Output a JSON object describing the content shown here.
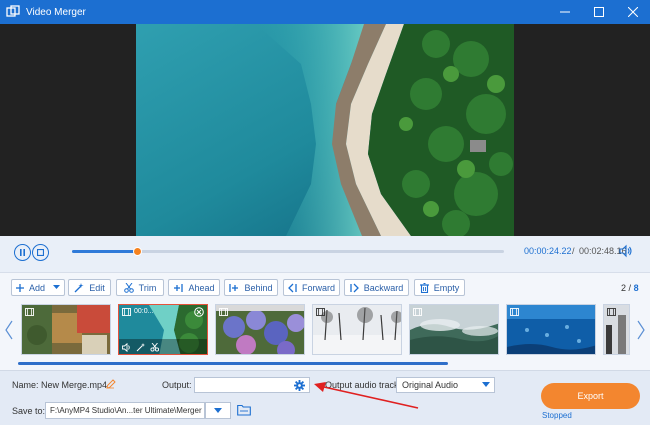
{
  "window": {
    "title": "Video Merger",
    "controls": [
      "minimize",
      "maximize",
      "close"
    ]
  },
  "playback": {
    "progress_percent": 15,
    "current_time": "00:00:24.22",
    "separator": "/",
    "total_time": "00:02:48.16"
  },
  "toolbar": {
    "add": "Add",
    "edit": "Edit",
    "trim": "Trim",
    "ahead": "Ahead",
    "behind": "Behind",
    "forward": "Forward",
    "backward": "Backward",
    "empty": "Empty"
  },
  "pagination": {
    "current": "2",
    "separator": "/",
    "total": "8"
  },
  "clips": {
    "selected_duration": "00:0..."
  },
  "bottom": {
    "name_label": "Name:",
    "name_value": "New Merge.mp4",
    "output_label": "Output:",
    "output_value": "",
    "audio_label": "Output audio track:",
    "audio_value": "Original Audio",
    "saveto_label": "Save to:",
    "saveto_value": "F:\\AnyMP4 Studio\\An...ter Ultimate\\Merger",
    "export_label": "Export",
    "status": "Stopped"
  },
  "colors": {
    "accent": "#1c6fd1",
    "export": "#f3862f",
    "knob": "#f58220",
    "selection": "#e6523b",
    "annotation_arrow": "#e02020"
  }
}
